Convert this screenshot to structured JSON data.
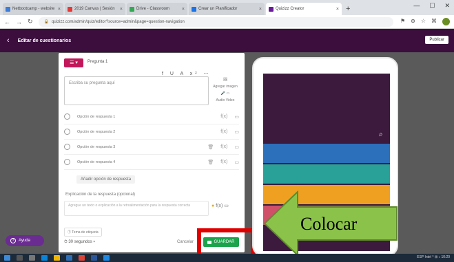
{
  "browser": {
    "tabs": [
      {
        "label": "Netbootcamp - website",
        "color": "#3d7dd8",
        "active": false
      },
      {
        "label": "2019 Canvas | Sesión",
        "color": "#e53935",
        "active": false
      },
      {
        "label": "Drive - Classroom",
        "color": "#34a853",
        "active": false
      },
      {
        "label": "Crear un Planificador",
        "color": "#1a73e8",
        "active": false
      },
      {
        "label": "Quizizz Creator",
        "color": "#6a1b9a",
        "active": true
      }
    ],
    "url": "quizizz.com/admin/quiz/editor?source=admin&page=question-navigation"
  },
  "app": {
    "back_icon": "arrow-left-icon",
    "title": "Editar de cuestionarios",
    "publish_label": "Publicar"
  },
  "editor": {
    "question_type": "☰ ▾",
    "question_label": "Pregunta 1",
    "format_tools": "f U A x² ⋯",
    "question_placeholder": "Escriba su pregunta aquí",
    "side_tools": [
      "Agregar imagen",
      "Audio",
      "Video"
    ],
    "answers": [
      {
        "text": "Opción de respuesta 1"
      },
      {
        "text": "Opción de respuesta 2"
      },
      {
        "text": "Opción de respuesta 3"
      },
      {
        "text": "Opción de respuesta 4"
      }
    ],
    "add_answer_label": "Añadir opción de respuesta",
    "feedback_label": "Explicación de la respuesta (opcional)",
    "feedback_placeholder": "Agregue un texto o explicación a la retroalimentación para la respuesta correcta",
    "hint_label": "Ⓣ Tema de etiqueta",
    "time_value": "⏱ 30 segundos ▾",
    "cancel_label": "Cancelar",
    "save_label": "GUARDAR"
  },
  "preview": {
    "stripe_colors": [
      "#2c6fbb",
      "#2aa198",
      "#f0a020",
      "#d0506a"
    ]
  },
  "annotation": {
    "arrow_color": "#8bc34a",
    "label": "Colocar"
  },
  "help_label": "Ayuda",
  "taskbar": {
    "tray_text": "ESP  Intel  ^  ⊞  ♪  10:20"
  }
}
